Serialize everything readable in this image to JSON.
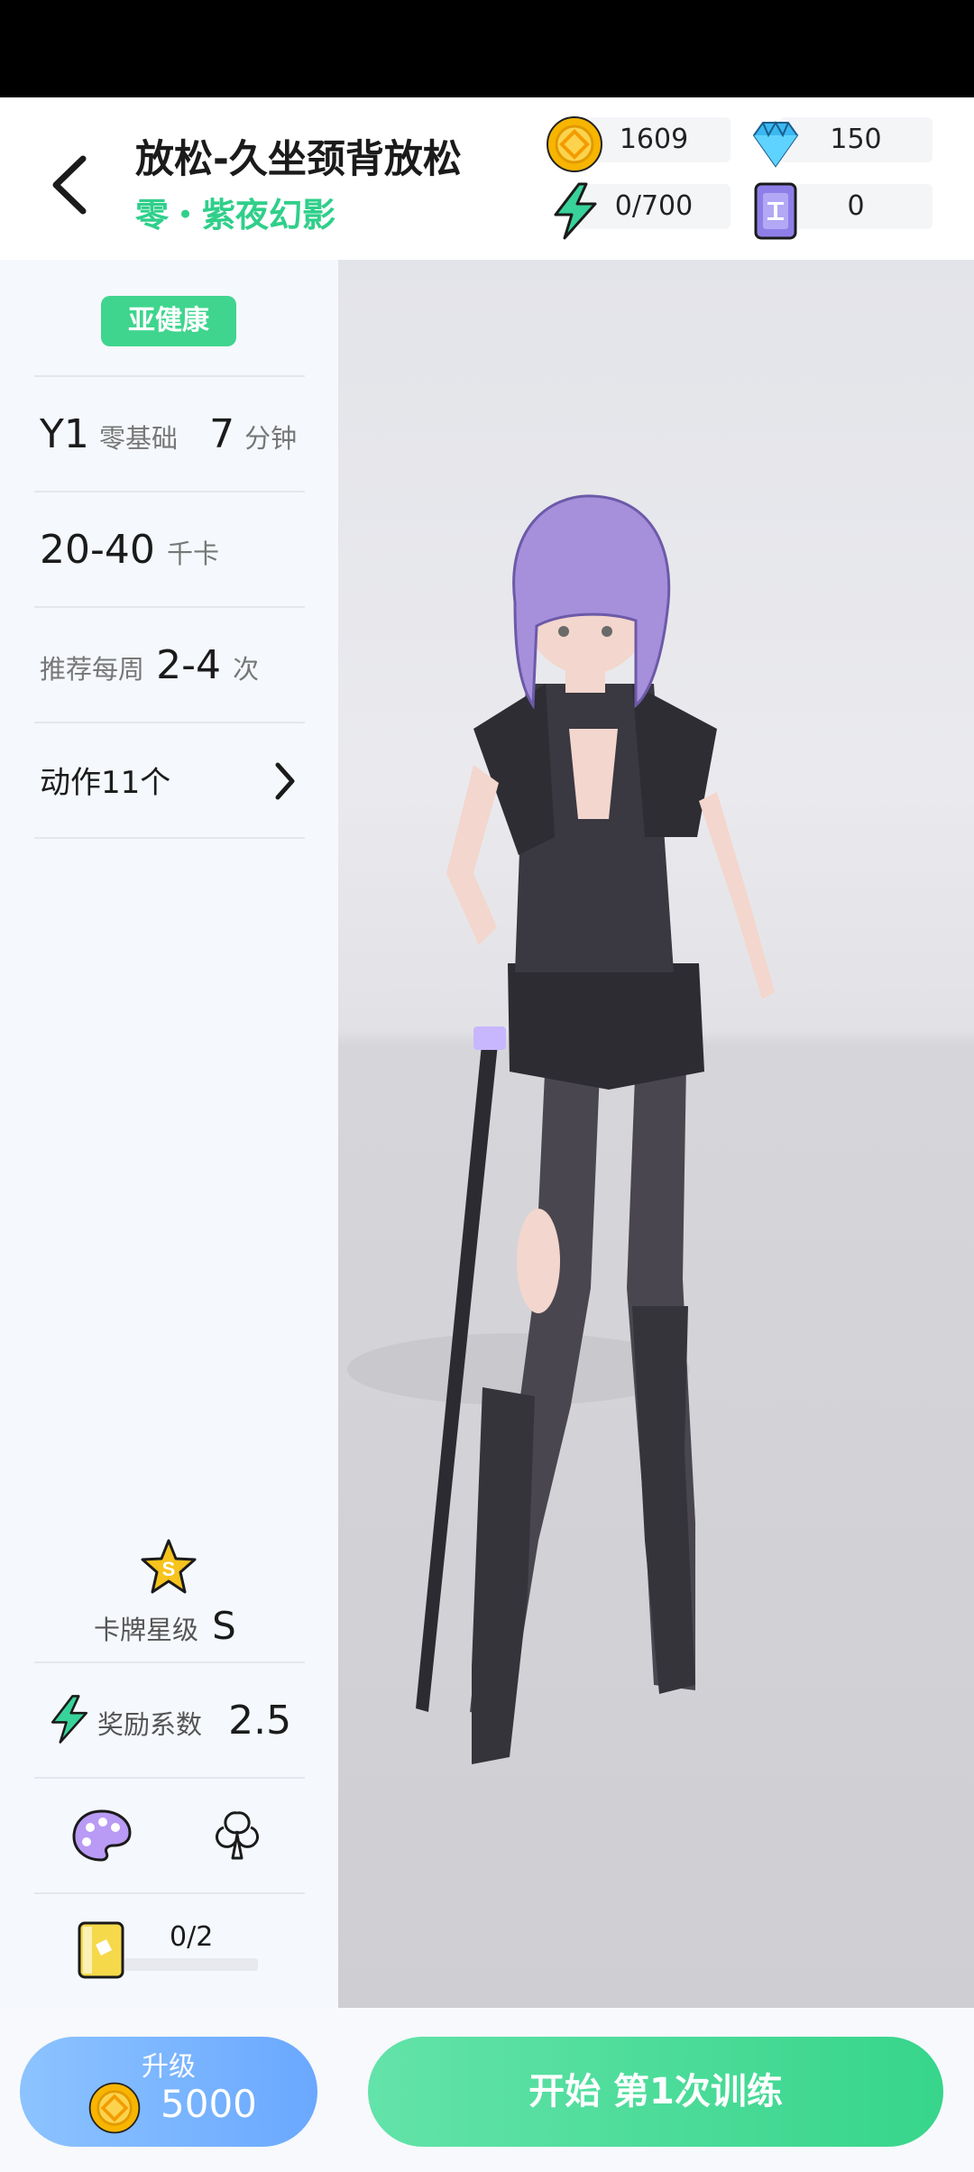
{
  "header": {
    "title": "放松-久坐颈背放松",
    "subtitle": "零・紫夜幻影",
    "resources": {
      "coins": "1609",
      "diamonds": "150",
      "energy": "0/700",
      "tickets": "0"
    }
  },
  "sidebar": {
    "tag": "亚健康",
    "level_code": "Y1",
    "level_label": "零基础",
    "duration_value": "7",
    "duration_unit": "分钟",
    "calories_value": "20-40",
    "calories_unit": "千卡",
    "weekly_prefix": "推荐每周",
    "weekly_value": "2-4",
    "weekly_unit": "次",
    "actions_label": "动作11个",
    "card_rank_label": "卡牌星级",
    "card_rank_value": "S",
    "star_letter": "S",
    "reward_label": "奖励系数",
    "reward_value": "2.5",
    "shards_progress": "0/2"
  },
  "bottom": {
    "upgrade_label": "升级",
    "upgrade_cost": "5000",
    "start_label": "开始 第1次训练"
  },
  "colors": {
    "accent_green": "#3fd58e",
    "subtitle_green": "#2fcf8a",
    "upgrade_blue": "#6aa8ff",
    "coin_gold": "#f7b500",
    "diamond_blue": "#3ab8f2",
    "ticket_purple": "#8e7fe8"
  },
  "icons": [
    "back-chevron-icon",
    "coin-icon",
    "diamond-icon",
    "lightning-icon",
    "ticket-icon",
    "chevron-right-icon",
    "star-s-icon",
    "palette-icon",
    "club-icon",
    "shard-card-icon"
  ]
}
